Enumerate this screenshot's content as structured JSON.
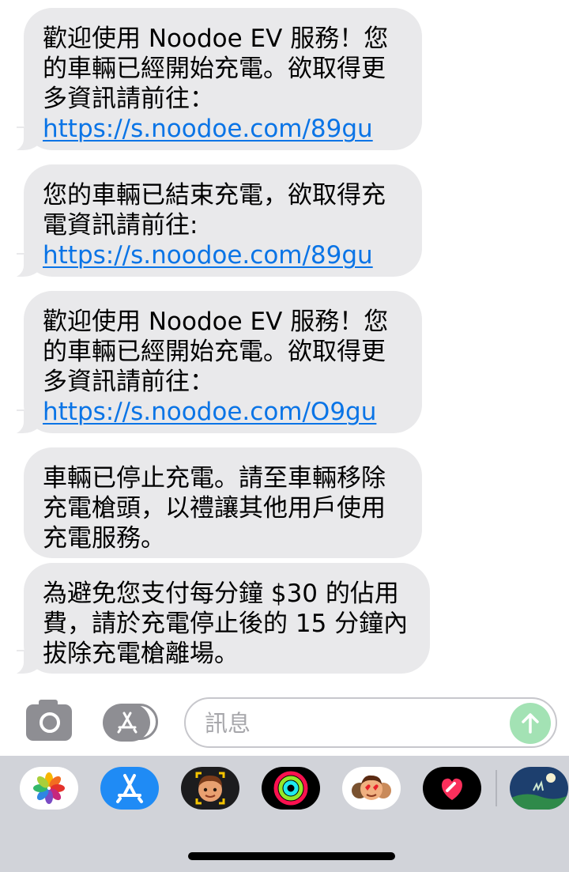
{
  "messages": [
    {
      "text": "歡迎使用 Noodoe EV 服務！您的車輛已經開始充電。欲取得更多資訊請前往：",
      "link": "https://s.noodoe.com/89gu"
    },
    {
      "text": "您的車輛已結束充電，欲取得充電資訊請前往: ",
      "link": "https://s.noodoe.com/89gu"
    },
    {
      "text": "歡迎使用 Noodoe EV 服務！您的車輛已經開始充電。欲取得更多資訊請前往：",
      "link": "https://s.noodoe.com/O9gu"
    },
    {
      "text": "車輛已停止充電。請至車輛移除充電槍頭，以禮讓其他用戶使用充電服務。",
      "link": ""
    },
    {
      "text": "為避免您支付每分鐘 $30 的佔用費，請於充電停止後的 15 分鐘內拔除充電槍離場。",
      "link": ""
    }
  ],
  "compose": {
    "placeholder": "訊息",
    "value": "",
    "camera_icon": "camera-icon",
    "apps_icon": "app-store-icon",
    "send_icon": "arrow-up-icon"
  },
  "app_drawer": {
    "apps": [
      "photos-icon",
      "app-store-icon",
      "memoji-icon",
      "activity-icon",
      "animoji-stickers-icon",
      "digital-touch-icon",
      "weather-app-icon"
    ]
  },
  "colors": {
    "bubble": "#e9e9eb",
    "link": "#0a74e6",
    "send_disabled": "#a3e2b4",
    "tray": "#d1d3d9"
  }
}
